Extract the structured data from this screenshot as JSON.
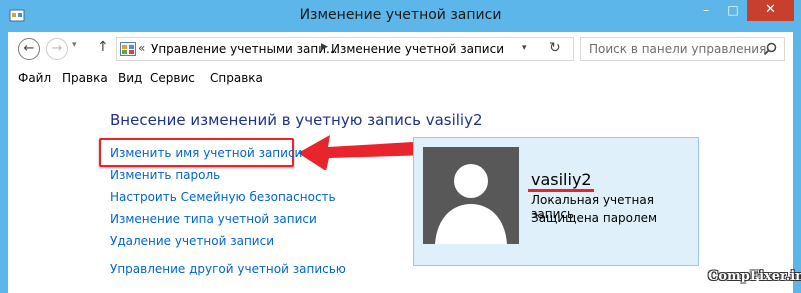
{
  "window": {
    "title": "Изменение учетной записи",
    "controls": {
      "minimize": "–",
      "maximize": "□",
      "close": "✕"
    },
    "title_bar_color": "#5cb6ea",
    "close_button_color": "#c7402d"
  },
  "navigation": {
    "back_icon": "←",
    "forward_icon": "→",
    "history_icon": "▾",
    "up_icon": "↑",
    "address_overflow": "«",
    "breadcrumbs": [
      "Управление учетными запи...",
      "Изменение учетной записи"
    ],
    "breadcrumb_separator": "▶",
    "dropdown_icon": "▾",
    "refresh_icon": "↻",
    "search_placeholder": "Поиск в панели управления"
  },
  "menu": {
    "items": [
      "Файл",
      "Правка",
      "Вид",
      "Сервис",
      "Справка"
    ]
  },
  "main": {
    "heading": "Внесение изменений в учетную запись vasiliy2",
    "links": {
      "rename": "Изменить имя учетной записи",
      "password": "Изменить пароль",
      "family_safety": "Настроить Семейную безопасность",
      "change_type": "Изменение типа учетной записи",
      "delete": "Удаление учетной записи",
      "manage_other": "Управление другой учетной записью"
    },
    "link_color": "#0066cc",
    "heading_color": "#1e3287",
    "annotation_color": "#e8242c"
  },
  "account": {
    "name": "vasiliy2",
    "type": "Локальная учетная запись",
    "protection": "Защищена паролем"
  },
  "watermark": "CompFixer.info"
}
